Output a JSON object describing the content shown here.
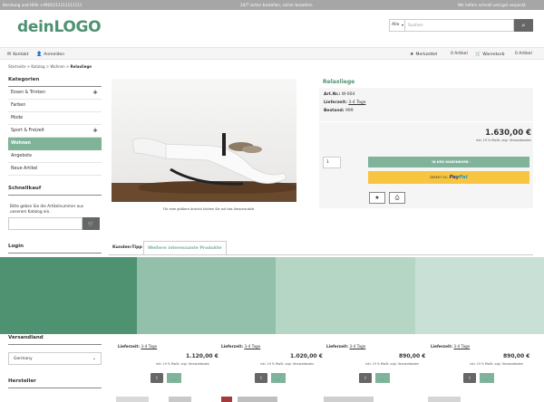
{
  "topbar": {
    "left": "Beratung und Hilfe +49(0)111111111111",
    "center": "24/7 sicher bestellen, sicher bezahlen",
    "right": "Wir liefern schnell und gut verpackt"
  },
  "logo": {
    "part1": "dein",
    "part2": "LOGO"
  },
  "search": {
    "scope": "Alle",
    "placeholder": "Suchen"
  },
  "nav": {
    "kontakt": "Kontakt",
    "anmelden": "Anmelden",
    "merkzettel": "Merkzettel",
    "merkzettel_count": "0 Artikel",
    "warenkorb": "Warenkorb",
    "warenkorb_count": "0 Artikel"
  },
  "breadcrumb": {
    "items": [
      "Startseite",
      "Katalog",
      "Wohnen"
    ],
    "current": "Relaxliege"
  },
  "sidebar": {
    "categories_title": "Kategorien",
    "categories": [
      {
        "label": "Essen & Trinken",
        "expandable": true
      },
      {
        "label": "Farben",
        "expandable": false
      },
      {
        "label": "Mode",
        "expandable": false
      },
      {
        "label": "Sport & Freizeit",
        "expandable": true
      },
      {
        "label": "Wohnen",
        "expandable": false,
        "active": true
      },
      {
        "label": "Angebote",
        "expandable": false
      },
      {
        "label": "Neue Artikel",
        "expandable": false
      }
    ],
    "quickbuy_title": "Schnellkauf",
    "quickbuy_text": "Bitte geben Sie die Artikelnummer aus unserem Katalog ein.",
    "login_title": "Login",
    "shipping_title": "Versandland",
    "country": "Germany",
    "brands_title": "Hersteller"
  },
  "product": {
    "title": "Relaxliege",
    "image_caption": "Für eine größere Ansicht klicken Sie auf das Vorschaubild",
    "art_label": "Art.Nr.:",
    "art_value": "W-004",
    "delivery_label": "Lieferzeit:",
    "delivery_value": "3-4 Tage",
    "stock_label": "Bestand:",
    "stock_value": "999",
    "price": "1.630,00 €",
    "price_note": "inkl. 19 % MwSt. zzgl. Versandkosten",
    "qty": "1",
    "cart_button": "IN DEN WARENKORB",
    "paypal_prefix": "DIREKT ZU",
    "paypal_pay": "Pay",
    "paypal_pal": "Pal"
  },
  "tabs": {
    "tab1": "Kunden-Tipp",
    "tab2": "Weitere interessante Produkte"
  },
  "colors": {
    "band": [
      "#4e9272",
      "#93c0aa",
      "#b5d5c5",
      "#c8e0d6"
    ]
  },
  "cards": [
    {
      "delivery_label": "Lieferzeit:",
      "delivery_value": "3-4 Tage",
      "price": "1.120,00 €",
      "note": "inkl. 19 % MwSt. zzgl. Versandkosten"
    },
    {
      "delivery_label": "Lieferzeit:",
      "delivery_value": "3-4 Tage",
      "price": "1.020,00 €",
      "note": "inkl. 19 % MwSt. zzgl. Versandkosten"
    },
    {
      "delivery_label": "Lieferzeit:",
      "delivery_value": "3-4 Tage",
      "price": "890,00 €",
      "note": "inkl. 19 % MwSt. zzgl. Versandkosten"
    },
    {
      "delivery_label": "Lieferzeit:",
      "delivery_value": "3-4 Tage",
      "price": "890,00 €",
      "note": "inkl. 19 % MwSt. zzgl. Versandkosten"
    }
  ]
}
